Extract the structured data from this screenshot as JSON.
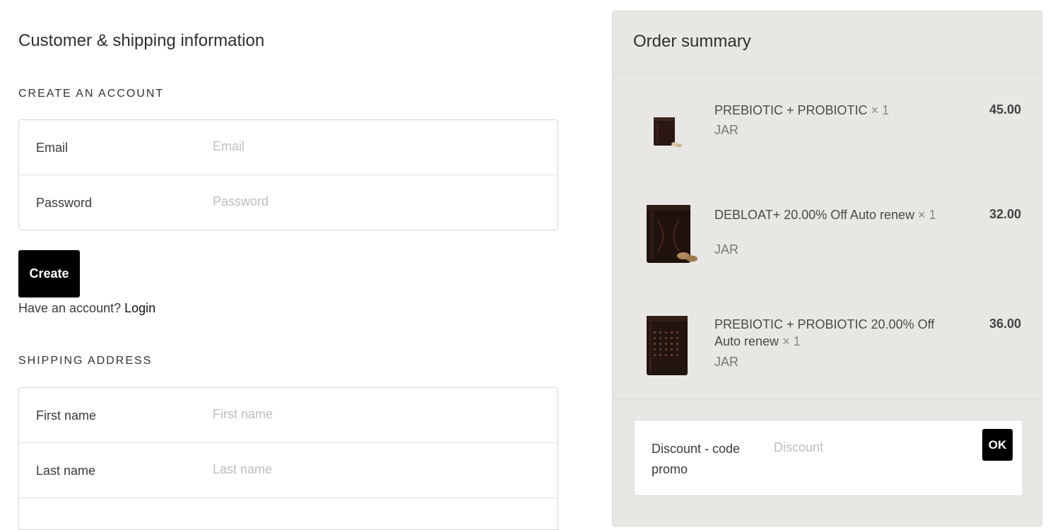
{
  "customer": {
    "title": "Customer & shipping information",
    "account_section": "CREATE AN ACCOUNT",
    "email_label": "Email",
    "email_placeholder": "Email",
    "password_label": "Password",
    "password_placeholder": "Password",
    "create_label": "Create",
    "have_account_text": "Have an account?",
    "login_label": "Login"
  },
  "shipping": {
    "section_title": "SHIPPING ADDRESS",
    "first_name_label": "First name",
    "first_name_placeholder": "First name",
    "last_name_label": "Last name",
    "last_name_placeholder": "Last name"
  },
  "summary": {
    "title": "Order summary",
    "items": [
      {
        "name": "PREBIOTIC + PROBIOTIC",
        "qty": "× 1",
        "variant": "JAR",
        "price": "45.00",
        "icon": "jar-icon"
      },
      {
        "name": "DEBLOAT+ 20.00% Off Auto renew",
        "qty": "× 1",
        "variant": "JAR",
        "price": "32.00",
        "icon": "jar-icon"
      },
      {
        "name": "PREBIOTIC + PROBIOTIC 20.00% Off Auto renew",
        "qty": "× 1",
        "variant": "JAR",
        "price": "36.00",
        "icon": "jar-icon"
      }
    ],
    "discount_label": "Discount - code promo",
    "discount_placeholder": "Discount",
    "ok_label": "OK"
  }
}
